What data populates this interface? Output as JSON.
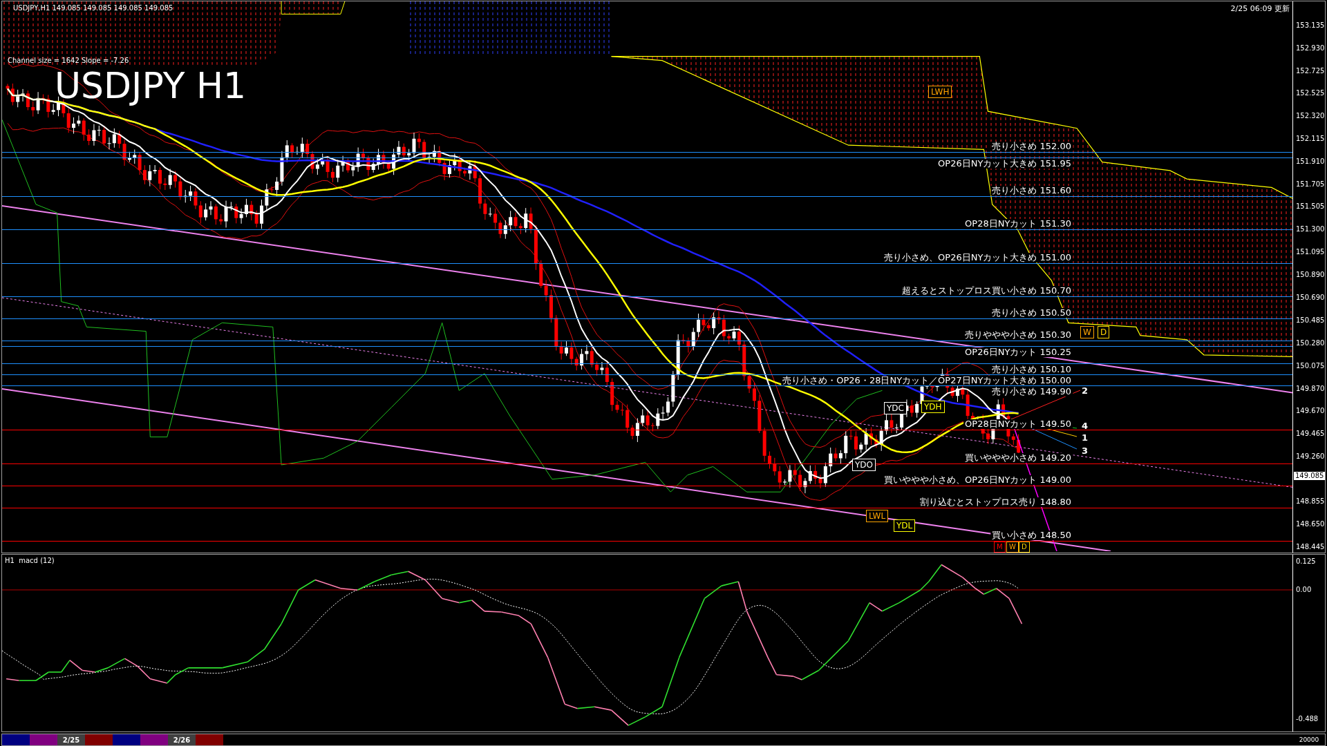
{
  "header": {
    "symbol_line": "USDJPY,H1  149.085 149.085 149.085 149.085",
    "channel_info": "Channel size = 1642 Slope = -7.26",
    "title": "USDJPY H1",
    "updated": "2/25 06:09 更新"
  },
  "price_axis": {
    "ticks": [
      "153.135",
      "152.930",
      "152.725",
      "152.525",
      "152.320",
      "152.115",
      "151.910",
      "151.705",
      "151.505",
      "151.300",
      "151.095",
      "150.890",
      "150.690",
      "150.485",
      "150.280",
      "150.075",
      "149.870",
      "149.670",
      "149.465",
      "149.260",
      "148.855",
      "148.650",
      "148.445"
    ],
    "current_price": "149.085"
  },
  "levels": [
    {
      "label": "売り小さめ 152.00",
      "color": "#1e90ff"
    },
    {
      "label": "OP26日NYカット大きめ 151.95",
      "color": "#1e90ff"
    },
    {
      "label": "売り小さめ 151.60",
      "color": "#1e90ff"
    },
    {
      "label": "OP28日NYカット 151.30",
      "color": "#1e90ff"
    },
    {
      "label": "売り小さめ、OP26日NYカット大きめ 151.00",
      "color": "#1e90ff"
    },
    {
      "label": "超えるとストップロス買い小さめ 150.70",
      "color": "#1e90ff"
    },
    {
      "label": "売り小さめ 150.50",
      "color": "#1e90ff"
    },
    {
      "label": "売りややや小さめ 150.30",
      "color": "#1e90ff"
    },
    {
      "label": "OP26日NYカット 150.25",
      "color": "#1e90ff"
    },
    {
      "label": "売り小さめ 150.10",
      "color": "#1e90ff"
    },
    {
      "label": "売り小さめ・OP26・28日NYカット／OP27日NYカット大きめ 150.00",
      "color": "#1e90ff"
    },
    {
      "label": "売り小さめ 149.90",
      "color": "#1e90ff"
    },
    {
      "label": "OP28日NYカット 149.50",
      "color": "#ff0000"
    },
    {
      "label": "買いややや小さめ 149.20",
      "color": "#ff0000"
    },
    {
      "label": "買いややや小さめ、OP26日NYカット 149.00",
      "color": "#ff0000"
    },
    {
      "label": "割り込むとストップロス売り 148.80",
      "color": "#ff0000"
    },
    {
      "label": "買い小さめ 148.50",
      "color": "#ff0000"
    }
  ],
  "markers": [
    {
      "label": "LWH",
      "color": "#ffa500"
    },
    {
      "label": "W",
      "color": "#ffa500"
    },
    {
      "label": "D",
      "color": "#ffd700"
    },
    {
      "label": "YDH",
      "color": "#ffff00"
    },
    {
      "label": "YDC",
      "color": "#ffffff"
    },
    {
      "label": "YDO",
      "color": "#ffffff"
    },
    {
      "label": "LWL",
      "color": "#ffa500"
    },
    {
      "label": "YDL",
      "color": "#ffff00"
    },
    {
      "label": "M",
      "color": "#ff0000"
    },
    {
      "label": "W",
      "color": "#ffa500"
    },
    {
      "label": "D",
      "color": "#ffd700"
    }
  ],
  "trend_labels": [
    "2",
    "4",
    "1",
    "3"
  ],
  "macd": {
    "title": "H1  macd (12)",
    "axis": [
      "0.125",
      "0.00",
      "-0.488"
    ]
  },
  "bottom_bar": {
    "segments": [
      {
        "color": "#000080"
      },
      {
        "color": "#800080"
      },
      {
        "color": "#404040",
        "label": "2/25"
      },
      {
        "color": "#800000"
      },
      {
        "color": "#000080"
      },
      {
        "color": "#800080"
      },
      {
        "color": "#404040",
        "label": "2/26"
      },
      {
        "color": "#800000"
      }
    ],
    "volume": "20000"
  }
}
